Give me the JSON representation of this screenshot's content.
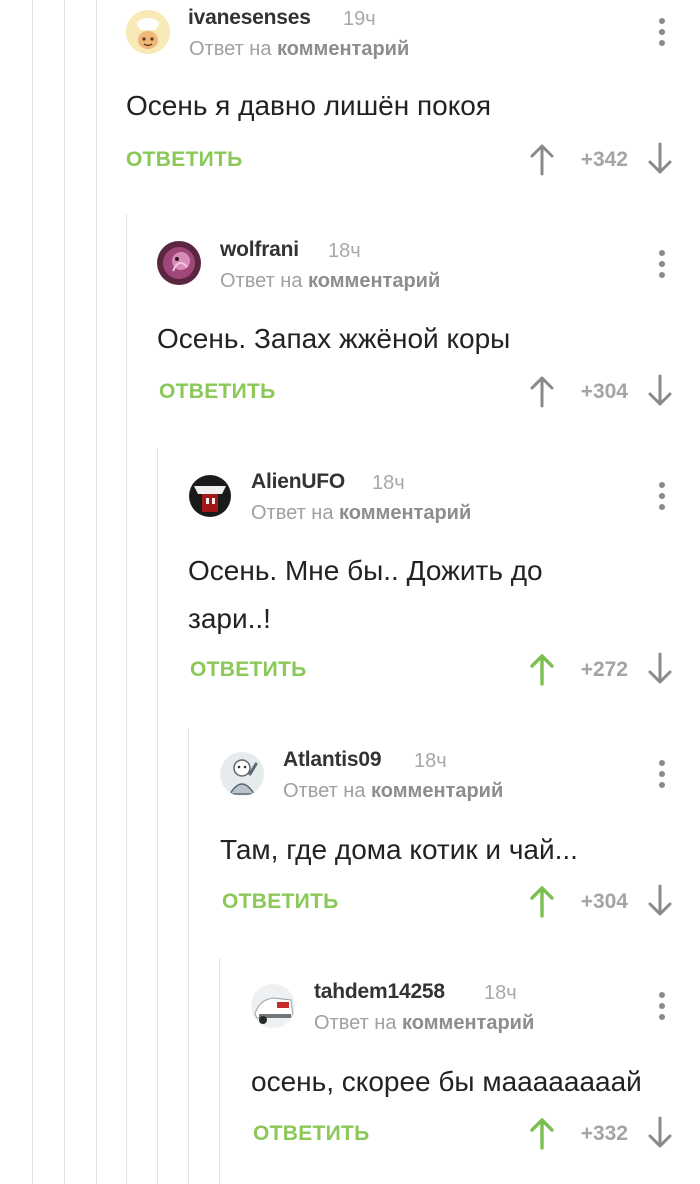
{
  "comments": [
    {
      "author": "ivanesenses",
      "time": "19ч",
      "reply_prefix": "Ответ на",
      "reply_link": "комментарий",
      "text": "Осень я давно лишён покоя",
      "reply_label": "ОТВЕТИТЬ",
      "rating": "+342",
      "upvoted": false
    },
    {
      "author": "wolfrani",
      "time": "18ч",
      "reply_prefix": "Ответ на",
      "reply_link": "комментарий",
      "text": "Осень. Запах жжёной коры",
      "reply_label": "ОТВЕТИТЬ",
      "rating": "+304",
      "upvoted": false
    },
    {
      "author": "AlienUFO",
      "time": "18ч",
      "reply_prefix": "Ответ на",
      "reply_link": "комментарий",
      "text": "Осень. Мне бы.. Дожить до зари..!",
      "reply_label": "ОТВЕТИТЬ",
      "rating": "+272",
      "upvoted": true
    },
    {
      "author": "Atlantis09",
      "time": "18ч",
      "reply_prefix": "Ответ на",
      "reply_link": "комментарий",
      "text": "Там, где дома котик и чай...",
      "reply_label": "ОТВЕТИТЬ",
      "rating": "+304",
      "upvoted": true
    },
    {
      "author": "tahdem14258",
      "time": "18ч",
      "reply_prefix": "Ответ на",
      "reply_link": "комментарий",
      "text": "осень, скорее бы маааааааай",
      "reply_label": "ОТВЕТИТЬ",
      "rating": "+332",
      "upvoted": true
    }
  ],
  "colors": {
    "reply_green": "#8ac858",
    "upvote_active": "#7bbf4f",
    "vote_neutral": "#8a8a8a",
    "thread_line": "#e3e3e3"
  }
}
